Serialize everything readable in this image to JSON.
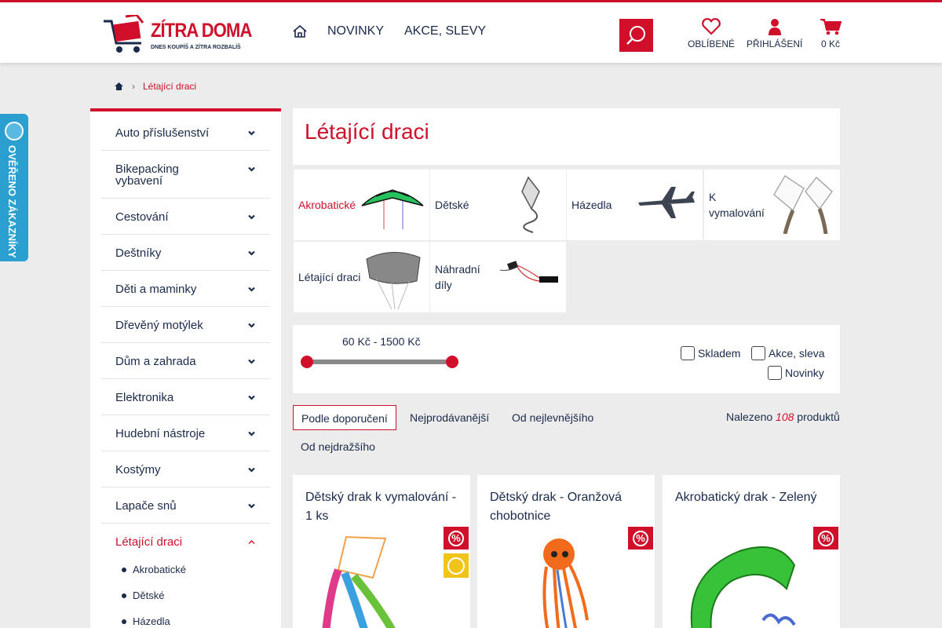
{
  "header": {
    "logo_text": "ZÍTRA DOMA",
    "logo_tagline": "DNES KOUPÍŠ A ZÍTRA ROZBALÍŠ",
    "nav": [
      "NOVINKY",
      "AKCE, SLEVY"
    ],
    "favorites_label": "OBLÍBENÉ",
    "login_label": "PŘIHLÁŠENÍ",
    "cart_total": "0 Kč",
    "accent_color": "#d0102a"
  },
  "breadcrumb": {
    "current": "Létající draci"
  },
  "badge": {
    "text": "OVĚŘENO ZÁKAZNÍKY"
  },
  "sidebar": {
    "items": [
      {
        "label": "Auto příslušenství"
      },
      {
        "label": "Bikepacking vybavení"
      },
      {
        "label": "Cestování"
      },
      {
        "label": "Deštníky"
      },
      {
        "label": "Děti a maminky"
      },
      {
        "label": "Dřevěný motýlek"
      },
      {
        "label": "Dům a zahrada"
      },
      {
        "label": "Elektronika"
      },
      {
        "label": "Hudební nástroje"
      },
      {
        "label": "Kostýmy"
      },
      {
        "label": "Lapače snů"
      },
      {
        "label": "Létající draci"
      }
    ],
    "subitems": [
      "Akrobatické",
      "Dětské",
      "Házedla"
    ]
  },
  "page": {
    "title": "Létající draci"
  },
  "categories": [
    {
      "label": "Akrobatické"
    },
    {
      "label": "Dětské"
    },
    {
      "label": "Házedla"
    },
    {
      "label": "K vymalování"
    },
    {
      "label": "Létající draci"
    },
    {
      "label": "Náhradní díly"
    }
  ],
  "filter": {
    "price_range": "60 Kč - 1500 Kč",
    "checkboxes": [
      "Skladem",
      "Akce, sleva",
      "Novinky"
    ]
  },
  "sort": {
    "options": [
      "Podle doporučení",
      "Nejprodávanější",
      "Od nejlevnějšího",
      "Od nejdražšího"
    ],
    "found_prefix": "Nalezeno",
    "found_count": "108",
    "found_suffix": "produktů"
  },
  "products": [
    {
      "name": "Dětský drak k vymalování - 1 ks",
      "discount_badge": "%"
    },
    {
      "name": "Dětský drak - Oranžová chobotnice",
      "discount_badge": "%"
    },
    {
      "name": "Akrobatický drak - Zelený",
      "discount_badge": "%"
    }
  ]
}
